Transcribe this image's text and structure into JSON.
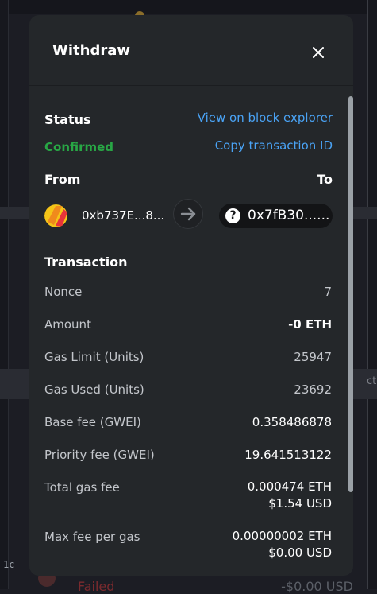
{
  "modal": {
    "title": "Withdraw"
  },
  "status": {
    "heading": "Status",
    "value": "Confirmed",
    "view_explorer": "View on block explorer",
    "copy_tx": "Copy transaction ID"
  },
  "parties": {
    "from_label": "From",
    "to_label": "To",
    "from_address": "0xb737E...8...",
    "to_address": "0x7fB30......",
    "to_icon_glyph": "?"
  },
  "transaction": {
    "heading": "Transaction",
    "rows": [
      {
        "label": "Nonce",
        "value": "7"
      },
      {
        "label": "Amount",
        "value": "-0 ETH"
      },
      {
        "label": "Gas Limit (Units)",
        "value": "25947"
      },
      {
        "label": "Gas Used (Units)",
        "value": "23692"
      },
      {
        "label": "Base fee (GWEI)",
        "value": "0.358486878"
      },
      {
        "label": "Priority fee (GWEI)",
        "value": "19.641513122"
      },
      {
        "label": "Total gas fee",
        "value": "0.000474 ETH",
        "value2": "$1.54 USD"
      },
      {
        "label": "Max fee per gas",
        "value": "0.00000002 ETH",
        "value2": "$0.00 USD"
      }
    ]
  },
  "background": {
    "right_fragment": "ctio",
    "left_fragment": "1c",
    "failed_text": "Failed",
    "usd_text": "-$0.00 USD"
  },
  "colors": {
    "modal_bg": "#24272a",
    "link": "#4aa3f5",
    "success": "#28a745",
    "text_muted": "#c3c6cb"
  },
  "icons": {
    "close": "close-icon",
    "arrow": "arrow-right-icon",
    "from_avatar": "account-avatar-icon",
    "to_avatar": "question-mark-icon"
  }
}
